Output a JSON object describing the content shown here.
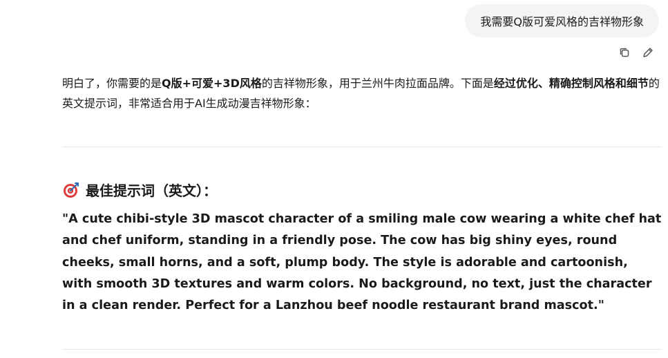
{
  "conversation": {
    "user_message": "我需要Q版可爱风格的吉祥物形象",
    "assistant": {
      "intro_parts": [
        {
          "text": "明白了，你需要的是",
          "bold": false
        },
        {
          "text": "Q版+可爱+3D风格",
          "bold": true
        },
        {
          "text": "的吉祥物形象，用于兰州牛肉拉面品牌。下面是",
          "bold": false
        },
        {
          "text": "经过优化、精确控制风格和细节",
          "bold": true
        },
        {
          "text": "的英文提示词，非常适合用于AI生成动漫吉祥物形象：",
          "bold": false
        }
      ],
      "section_title": "最佳提示词（英文）：",
      "section_icon": "target-icon",
      "prompt_text": "\"A cute chibi-style 3D mascot character of a smiling male cow wearing a white chef hat and chef uniform, standing in a friendly pose. The cow has big shiny eyes, round cheeks, small horns, and a soft, plump body. The style is adorable and cartoonish, with smooth 3D textures and warm colors. No background, no text, just the character in a clean render. Perfect for a Lanzhou beef noodle restaurant brand mascot.\""
    }
  },
  "actions": {
    "copy_icon": "copy-icon",
    "edit_icon": "edit-icon"
  },
  "colors": {
    "bubble_bg": "#f3f4f6",
    "text": "#1a1a1a",
    "icon": "#555555",
    "divider": "#e8e8e8",
    "target_red": "#e03b3b"
  }
}
